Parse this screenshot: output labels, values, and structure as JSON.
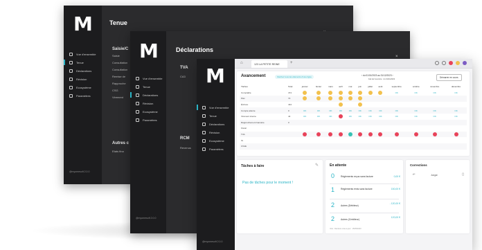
{
  "app": {
    "logo": "M",
    "version": "@myomesoft 2.0.0"
  },
  "nav": [
    {
      "label": "Vue d'ensemble"
    },
    {
      "label": "Tenue"
    },
    {
      "label": "Déclarations"
    },
    {
      "label": "Révision"
    },
    {
      "label": "Ecosystème"
    },
    {
      "label": "Paramètres"
    }
  ],
  "back_window": {
    "title": "Tenue",
    "close": "×",
    "section": "Saisie/C",
    "lines": [
      "Saisie",
      "Consultation",
      "Consultation",
      "Remise de",
      "Rapproche",
      "CSG",
      "Virement"
    ],
    "section2": "Autres c",
    "line2": "Etats fina"
  },
  "mid_window": {
    "title": "Déclarations",
    "close": "×",
    "section": "TVA",
    "line": "CA3",
    "section2": "RCM",
    "line2": "Revenus"
  },
  "main": {
    "tab": "123 LA PETITE REINE",
    "avancement": {
      "title": "Avancement",
      "pill": "Flechez tous les éléments d'une ligne",
      "period": "du 01/01/2023 au 31/12/2023",
      "period_sub": "Fait de l'exercice : du 01/01/2023",
      "button": "Démarrer en cours",
      "col_taches": "Tâches",
      "col_total": "Total",
      "months": [
        "janvier",
        "février",
        "mars",
        "avril",
        "mai",
        "juin",
        "juillet",
        "août",
        "septembre",
        "octobre",
        "novembre",
        "décembre"
      ],
      "rows": [
        {
          "label": "Comptable",
          "total": "474",
          "cells": [
            "y",
            "y",
            "y",
            "y",
            "y",
            "y",
            "y",
            "y",
            "ok",
            "ok",
            "ok",
            "ok"
          ]
        },
        {
          "label": "Pièc",
          "total": "72",
          "cells": [
            "y",
            "y",
            "y",
            "y",
            "y",
            "y",
            "",
            "",
            "",
            "",
            "",
            ""
          ]
        },
        {
          "label": "Écriture",
          "total": "434",
          "cells": [
            "",
            "",
            "",
            "y",
            "",
            "y",
            "",
            "",
            "",
            "",
            "",
            ""
          ]
        },
        {
          "label": "Compte attente",
          "total": "0",
          "cells": [
            "ok",
            "ok",
            "ok",
            "ok",
            "ok",
            "ok",
            "ok",
            "ok",
            "ok",
            "ok",
            "ok",
            "ok"
          ]
        },
        {
          "label": "Virement interne",
          "total": "44",
          "cells": [
            "ok",
            "ok",
            "ok",
            "r",
            "ok",
            "ok",
            "ok",
            "ok",
            "ok",
            "ok",
            "ok",
            "ok"
          ]
        },
        {
          "label": "Rapprochement bancaire",
          "total": "0",
          "cells": [
            "",
            "",
            "",
            "",
            "",
            "",
            "",
            "",
            "",
            "",
            "",
            ""
          ]
        },
        {
          "label": "Fiscal",
          "total": "",
          "cells": [
            "",
            "",
            "",
            "",
            "",
            "",
            "",
            "",
            "",
            "",
            "",
            ""
          ]
        },
        {
          "label": "TVA",
          "total": "",
          "cells": [
            "r",
            "r",
            "r",
            "r",
            "t",
            "r",
            "r",
            "r",
            "r",
            "r",
            "r",
            "r"
          ]
        },
        {
          "label": "IS",
          "total": "",
          "cells": [
            "",
            "",
            "",
            "",
            "",
            "",
            "",
            "",
            "",
            "",
            "",
            ""
          ]
        },
        {
          "label": "CVAE",
          "total": "",
          "cells": [
            "",
            "",
            "",
            "",
            "",
            "",
            "",
            "",
            "",
            "",
            "",
            ""
          ]
        }
      ]
    },
    "taches": {
      "title": "Tâches à faire",
      "empty": "Pas de tâches pour le moment !"
    },
    "attente": {
      "title": "En attente",
      "items": [
        {
          "count": "0",
          "label": "Règlements reçus sans facture",
          "amount": "0,00 €"
        },
        {
          "count": "1",
          "label": "Règlements émis sans facture",
          "amount": "150,00 €"
        },
        {
          "count": "2",
          "label": "Autres (Débiteur)",
          "amount": "- 120,00 €"
        },
        {
          "count": "2",
          "label": "Autres (Créditeur)",
          "amount": "120,00 €"
        }
      ],
      "footer": "Vois : Dernière mise à jour : 15/05/2023"
    },
    "corrections": {
      "title": "Corrections",
      "item": "Jungat"
    }
  },
  "colors": {
    "accent": "#2ab4c6",
    "yellow": "#f2c14e",
    "red": "#e8435a",
    "green": "#36c2b4",
    "dark": "#2b2b2d"
  }
}
